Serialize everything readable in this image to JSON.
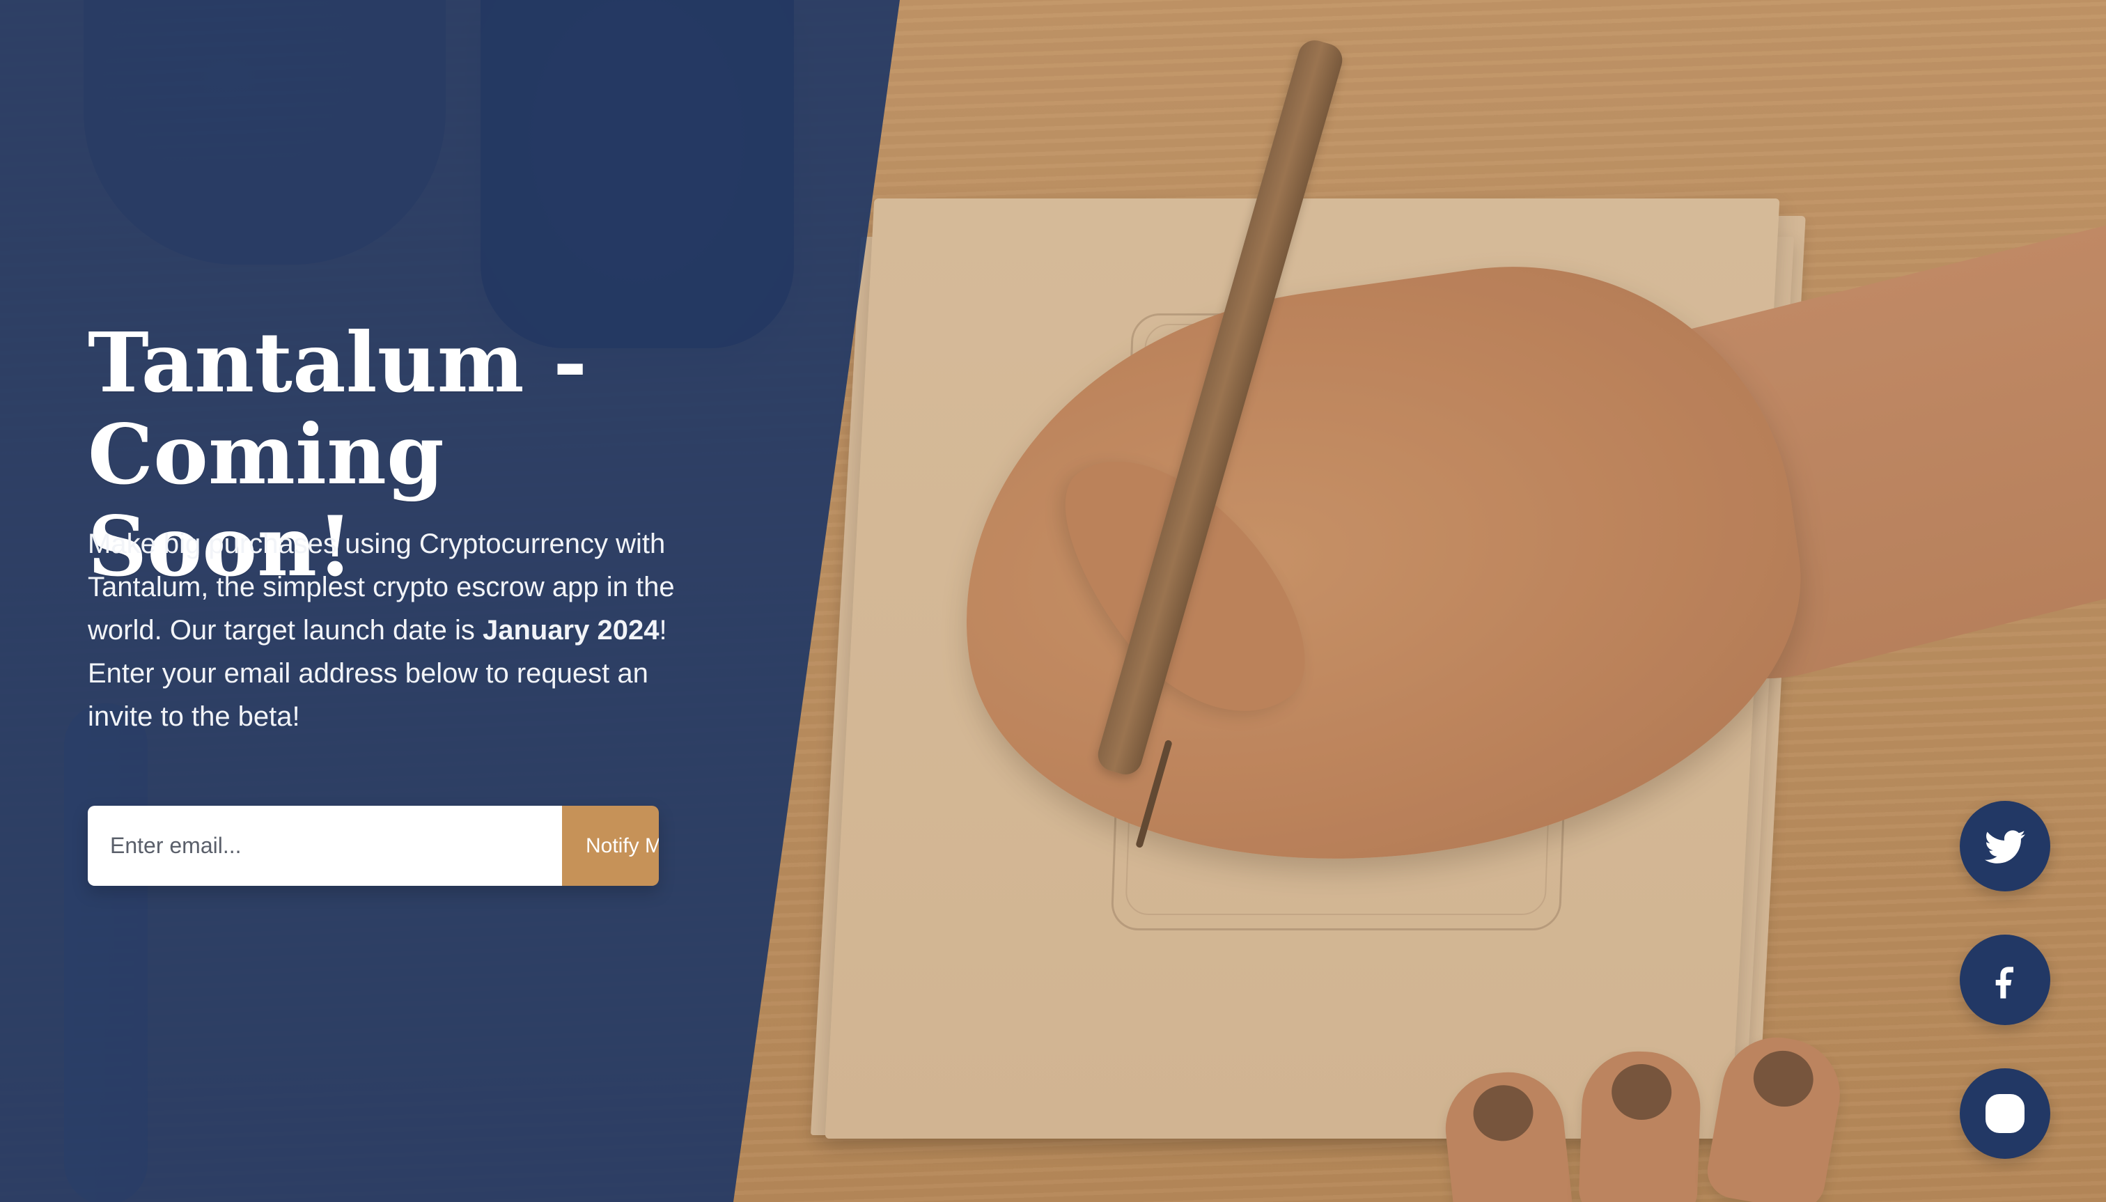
{
  "hero": {
    "title": "Tantalum -\nComing Soon!",
    "description": {
      "part1": "Make big purchases using Cryptocurrency with Tantalum, the simplest crypto escrow app in the world. Our target launch date is ",
      "launch_date": "January 2024",
      "part2": "! Enter your email address below to request an invite to the beta!"
    }
  },
  "signup": {
    "email_placeholder": "Enter email...",
    "email_value": "",
    "button_label": "Notify Me!"
  },
  "social": {
    "items": [
      {
        "name": "twitter",
        "icon": "twitter-icon"
      },
      {
        "name": "facebook",
        "icon": "facebook-icon"
      },
      {
        "name": "instagram",
        "icon": "instagram-icon"
      }
    ]
  },
  "colors": {
    "overlay_blue": "#223865",
    "button_tan": "#C69258",
    "white": "#FFFFFF"
  }
}
